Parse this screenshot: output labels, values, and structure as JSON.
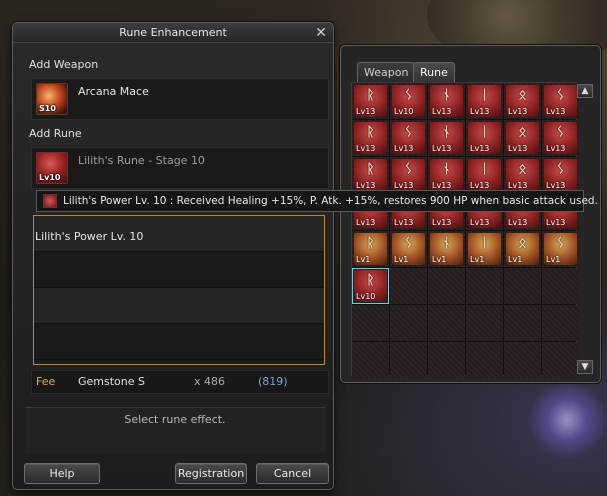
{
  "window": {
    "title": "Rune Enhancement",
    "close_label": "✕"
  },
  "add_weapon": {
    "label": "Add Weapon",
    "weapon_name": "Arcana Mace",
    "weapon_badge": "S10"
  },
  "add_rune": {
    "label": "Add Rune",
    "rune_name": "Lilith's Rune - Stage 10",
    "rune_badge": "Lv10"
  },
  "tooltip": {
    "text": "Lilith's Power Lv. 10 : Received Healing +15%, P. Atk. +15%, restores 900 HP when basic attack used."
  },
  "effects": {
    "selected_effect": "Lilith's Power Lv. 10"
  },
  "fee": {
    "label": "Fee",
    "item": "Gemstone S",
    "quantity": "x 486",
    "owned": "(819)"
  },
  "status_message": "Select rune effect.",
  "buttons": {
    "help": "Help",
    "registration": "Registration",
    "cancel": "Cancel"
  },
  "inventory": {
    "tabs": [
      "Weapon",
      "Rune"
    ],
    "active_tab": "Rune",
    "scroll_up": "▲",
    "scroll_down": "▼",
    "rows": [
      [
        "Lv13",
        "Lv10",
        "Lv13",
        "Lv13",
        "Lv13",
        "Lv13"
      ],
      [
        "Lv13",
        "Lv13",
        "Lv13",
        "Lv13",
        "Lv13",
        "Lv13"
      ],
      [
        "Lv13",
        "Lv13",
        "Lv13",
        "Lv13",
        "Lv13",
        "Lv13"
      ],
      [
        "Lv13",
        "Lv13",
        "Lv13",
        "Lv13",
        "Lv13",
        "Lv13"
      ],
      [
        "Lv1",
        "Lv1",
        "Lv1",
        "Lv1",
        "Lv1",
        "Lv1"
      ],
      [
        "Lv10",
        "",
        "",
        "",
        "",
        ""
      ],
      [
        "",
        "",
        "",
        "",
        "",
        ""
      ],
      [
        "",
        "",
        "",
        "",
        "",
        ""
      ]
    ],
    "gold_row_index": 4,
    "selected_slot": "Lv10"
  }
}
